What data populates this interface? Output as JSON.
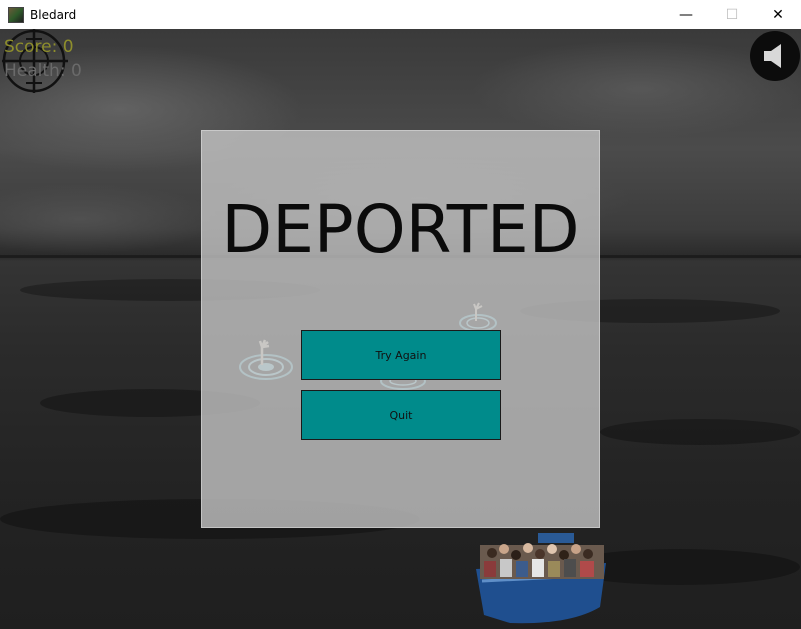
{
  "window": {
    "title": "Bledard",
    "controls": {
      "minimize": "—",
      "maximize": "☐",
      "close": "✕"
    }
  },
  "hud": {
    "score_label": "Score: 0",
    "health_label": "Health: 0"
  },
  "overlay": {
    "headline": "DEPORTED",
    "buttons": {
      "retry": "Try Again",
      "quit": "Quit"
    }
  },
  "colors": {
    "button_fill": "#008b8b",
    "score_text": "#8e8e2c",
    "health_text": "#6a6a6a",
    "panel": "#c4c4c4"
  },
  "icons": [
    "crosshair-icon",
    "speaker-icon",
    "app-icon"
  ]
}
